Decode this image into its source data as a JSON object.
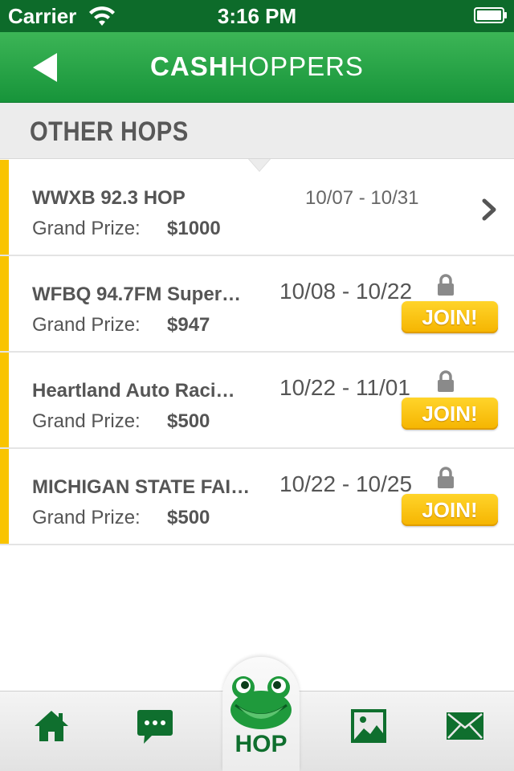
{
  "status_bar": {
    "carrier": "Carrier",
    "time": "3:16 PM",
    "wifi_icon": "wifi-icon",
    "battery_icon": "battery-icon"
  },
  "nav": {
    "back_icon": "back-arrow-icon",
    "brand_bold": "CASH",
    "brand_regular": "HOPPERS"
  },
  "section": {
    "title": "OTHER HOPS"
  },
  "hops": [
    {
      "name": "WWXB 92.3 HOP",
      "prize_label": "Grand Prize:",
      "prize": "$1000",
      "dates": "10/07 - 10/31",
      "locked": false
    },
    {
      "name": "WFBQ 94.7FM Super…",
      "prize_label": "Grand Prize:",
      "prize": "$947",
      "dates": "10/08 - 10/22",
      "locked": true,
      "join_label": "JOIN!"
    },
    {
      "name": "Heartland Auto Raci…",
      "prize_label": "Grand Prize:",
      "prize": "$500",
      "dates": "10/22 - 11/01",
      "locked": true,
      "join_label": "JOIN!"
    },
    {
      "name": "MICHIGAN STATE FAI…",
      "prize_label": "Grand Prize:",
      "prize": "$500",
      "dates": "10/22 - 10/25",
      "locked": true,
      "join_label": "JOIN!"
    }
  ],
  "tab_bar": {
    "items": [
      "home-icon",
      "chat-icon",
      "frog-icon",
      "photo-icon",
      "mail-icon"
    ],
    "hop_label": "HOP"
  },
  "colors": {
    "brand_green": "#17943a",
    "dark_green": "#0f6f2e",
    "accent_yellow": "#f9c400",
    "text_gray": "#555555"
  }
}
